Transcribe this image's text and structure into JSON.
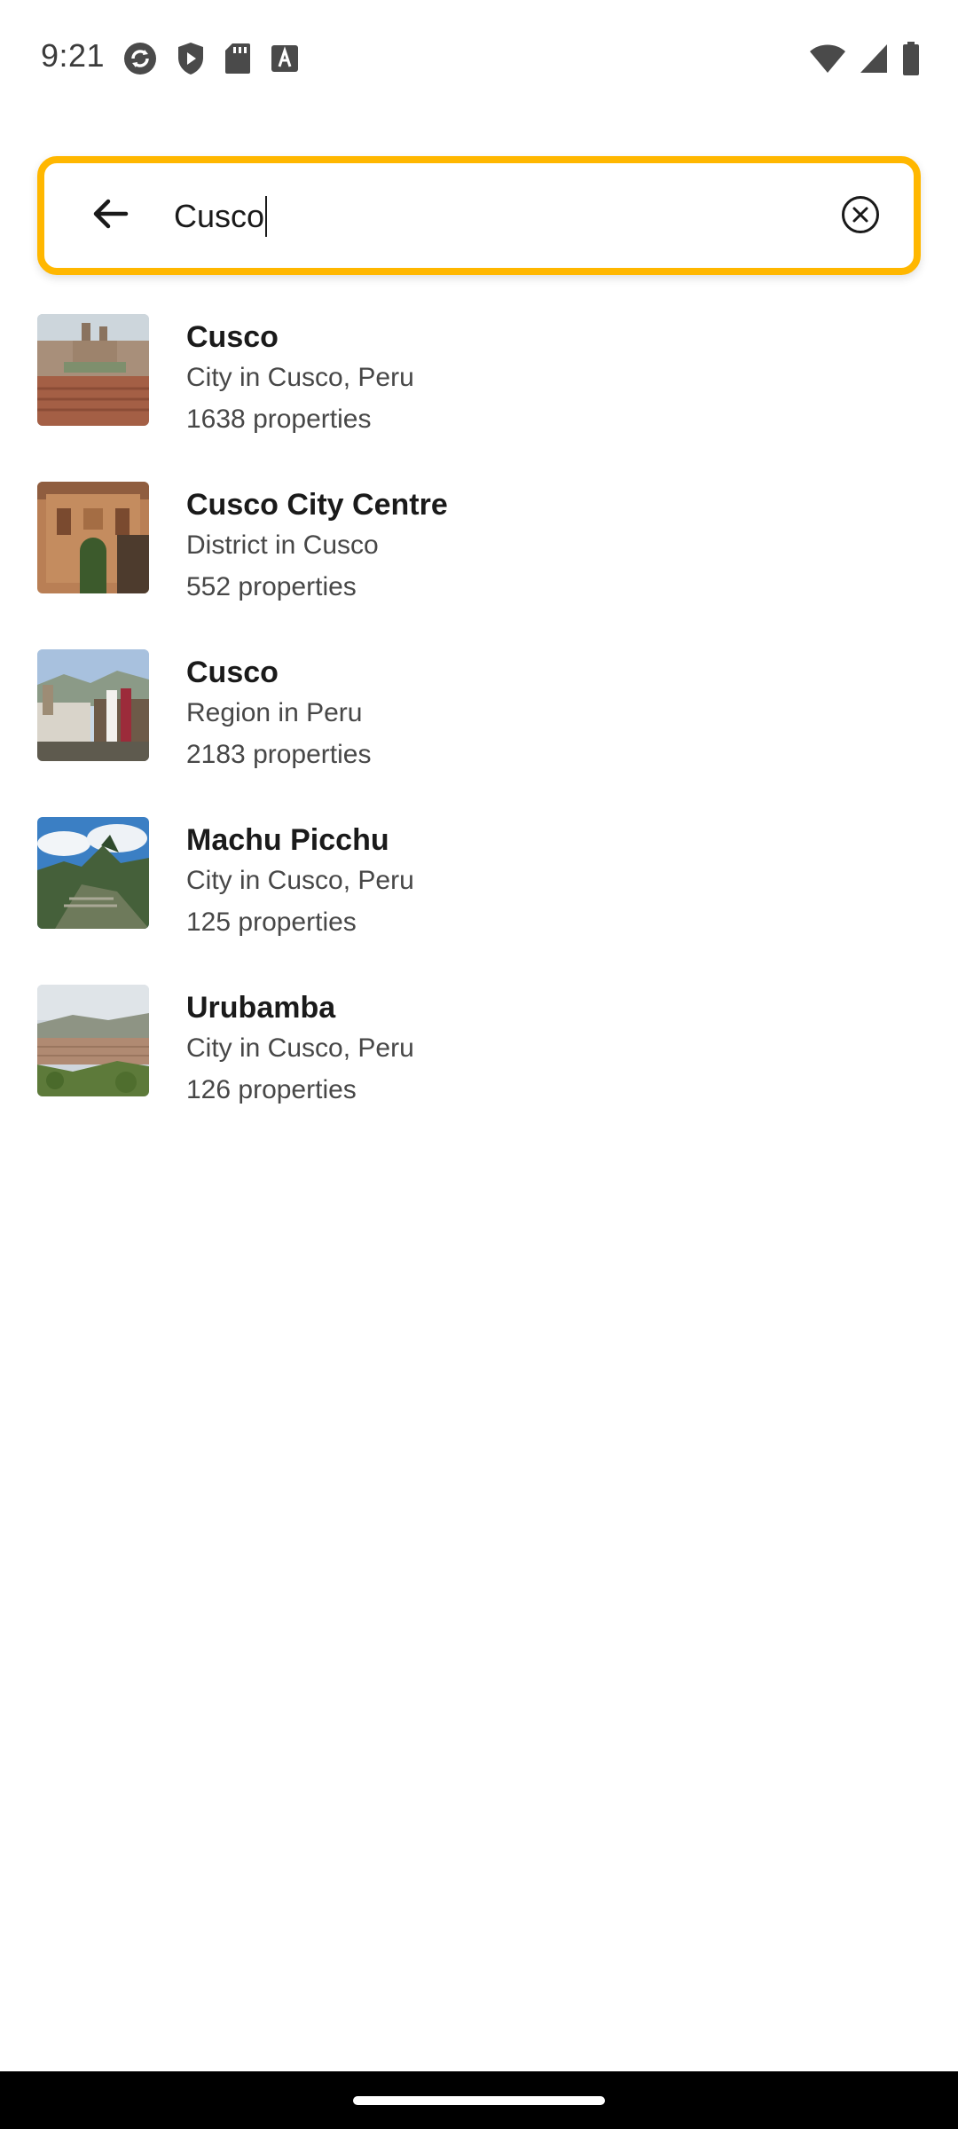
{
  "status_bar": {
    "time": "9:21",
    "icons_left": [
      "sync-icon",
      "shield-play-icon",
      "sd-card-icon",
      "font-a-icon"
    ],
    "icons_right": [
      "wifi-icon",
      "cellular-signal-icon",
      "battery-icon"
    ]
  },
  "search": {
    "value": "Cusco",
    "back_icon": "arrow-back-icon",
    "clear_icon": "clear-circle-icon",
    "accent_color": "#ffb700"
  },
  "results": [
    {
      "title": "Cusco",
      "subtitle": "City in Cusco, Peru",
      "count": "1638 properties",
      "thumb": "cusco-city-photo"
    },
    {
      "title": "Cusco City Centre",
      "subtitle": "District in Cusco",
      "count": "552 properties",
      "thumb": "cathedral-photo"
    },
    {
      "title": "Cusco",
      "subtitle": "Region in Peru",
      "count": "2183 properties",
      "thumb": "cusco-region-photo"
    },
    {
      "title": "Machu Picchu",
      "subtitle": "City in Cusco, Peru",
      "count": "125 properties",
      "thumb": "machu-picchu-photo"
    },
    {
      "title": "Urubamba",
      "subtitle": "City in Cusco, Peru",
      "count": "126 properties",
      "thumb": "urubamba-valley-photo"
    }
  ]
}
